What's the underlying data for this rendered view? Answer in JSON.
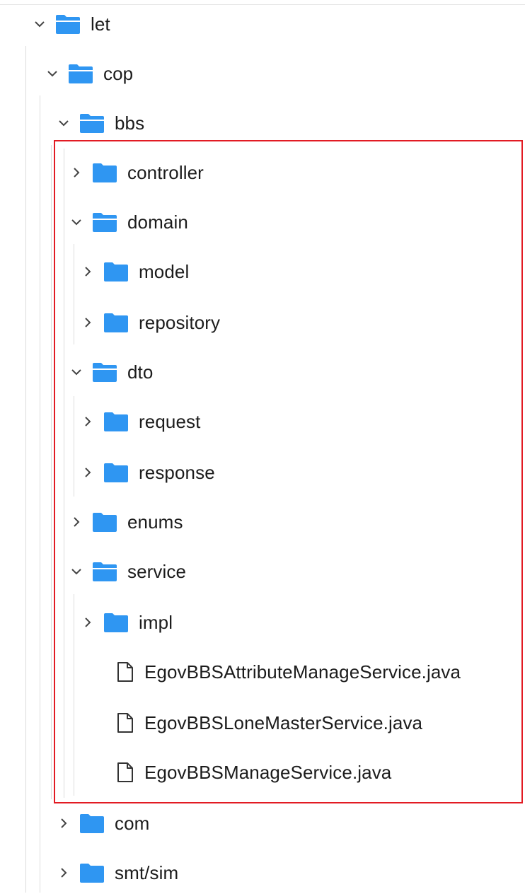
{
  "colors": {
    "folder": "#2f96f2",
    "highlight": "#e21b23",
    "text": "#1c1c1c"
  },
  "tree": {
    "let": {
      "label": "let",
      "icon": "folder-open-icon",
      "expanded": true
    },
    "cop": {
      "label": "cop",
      "icon": "folder-open-icon",
      "expanded": true
    },
    "bbs": {
      "label": "bbs",
      "icon": "folder-open-icon",
      "expanded": true
    },
    "controller": {
      "label": "controller",
      "icon": "folder-icon",
      "expanded": false
    },
    "domain": {
      "label": "domain",
      "icon": "folder-open-icon",
      "expanded": true
    },
    "model": {
      "label": "model",
      "icon": "folder-icon",
      "expanded": false
    },
    "repository": {
      "label": "repository",
      "icon": "folder-icon",
      "expanded": false
    },
    "dto": {
      "label": "dto",
      "icon": "folder-open-icon",
      "expanded": true
    },
    "request": {
      "label": "request",
      "icon": "folder-icon",
      "expanded": false
    },
    "response": {
      "label": "response",
      "icon": "folder-icon",
      "expanded": false
    },
    "enums": {
      "label": "enums",
      "icon": "folder-icon",
      "expanded": false
    },
    "service": {
      "label": "service",
      "icon": "folder-open-icon",
      "expanded": true
    },
    "impl": {
      "label": "impl",
      "icon": "folder-icon",
      "expanded": false
    },
    "file1": {
      "label": "EgovBBSAttributeManageService.java",
      "icon": "file-icon"
    },
    "file2": {
      "label": "EgovBBSLoneMasterService.java",
      "icon": "file-icon"
    },
    "file3": {
      "label": "EgovBBSManageService.java",
      "icon": "file-icon"
    },
    "com": {
      "label": "com",
      "icon": "folder-icon",
      "expanded": false
    },
    "smt": {
      "label": "smt/sim",
      "icon": "folder-icon",
      "expanded": false
    }
  }
}
